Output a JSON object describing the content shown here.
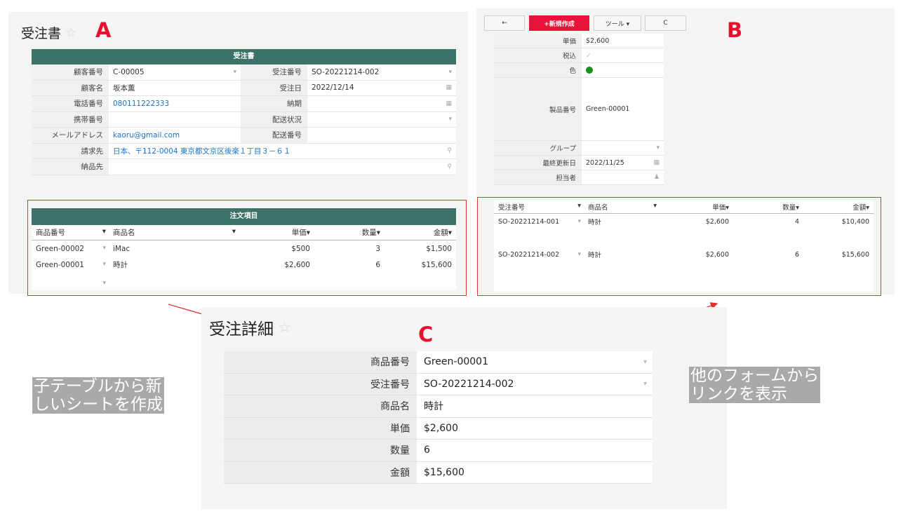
{
  "markers": {
    "a": "A",
    "b": "B",
    "c": "C"
  },
  "panel_a": {
    "title": "受注書",
    "form_header": "受注書",
    "rows": [
      {
        "l1": "顧客番号",
        "v1": "C-00005",
        "l2": "受注番号",
        "v2": "SO-20221214-002"
      },
      {
        "l1": "顧客名",
        "v1": "坂本薫",
        "l2": "受注日",
        "v2": "2022/12/14"
      },
      {
        "l1": "電話番号",
        "v1": "080111222333",
        "l2": "納期",
        "v2": ""
      },
      {
        "l1": "携帯番号",
        "v1": "",
        "l2": "配送状況",
        "v2": ""
      },
      {
        "l1": "メールアドレス",
        "v1": "kaoru@gmail.com",
        "l2": "配送番号",
        "v2": ""
      }
    ],
    "billing_label": "請求先",
    "billing_value": "日本、〒112-0004 東京都文京区後楽１丁目３－６１",
    "delivery_label": "納品先",
    "delivery_value": "",
    "items_header": "注文項目",
    "columns": [
      "商品番号",
      "商品名",
      "単価",
      "数量",
      "金額"
    ],
    "items": [
      {
        "code": "Green-00002",
        "name": "iMac",
        "price": "$500",
        "qty": "3",
        "amount": "$1,500"
      },
      {
        "code": "Green-00001",
        "name": "時計",
        "price": "$2,600",
        "qty": "6",
        "amount": "$15,600"
      }
    ]
  },
  "panel_b": {
    "toolbar": {
      "back": "←",
      "new": "+新規作成",
      "tools": "ツール ▾",
      "refresh": "C"
    },
    "fields": [
      {
        "label": "単価",
        "value": "$2,600"
      },
      {
        "label": "税込",
        "value": "✓"
      },
      {
        "label": "色",
        "value": ""
      },
      {
        "label": "製品番号",
        "value": "Green-00001"
      },
      {
        "label": "グループ",
        "value": ""
      },
      {
        "label": "最終更新日",
        "value": "2022/11/25"
      },
      {
        "label": "担当者",
        "value": ""
      }
    ],
    "color_dot": "#1a8f1a",
    "columns": [
      "受注番号",
      "商品名",
      "単価",
      "数量",
      "金額"
    ],
    "rows": [
      {
        "order": "SO-20221214-001",
        "name": "時計",
        "price": "$2,600",
        "qty": "4",
        "amount": "$10,400"
      },
      {
        "order": "SO-20221214-002",
        "name": "時計",
        "price": "$2,600",
        "qty": "6",
        "amount": "$15,600"
      }
    ]
  },
  "panel_c": {
    "title": "受注詳細",
    "rows": [
      {
        "label": "商品番号",
        "value": "Green-00001"
      },
      {
        "label": "受注番号",
        "value": "SO-20221214-002"
      },
      {
        "label": "商品名",
        "value": "時計"
      },
      {
        "label": "単価",
        "value": "$2,600"
      },
      {
        "label": "数量",
        "value": "6"
      },
      {
        "label": "金額",
        "value": "$15,600"
      }
    ]
  },
  "notes": {
    "left_line1": "子テーブルから新",
    "left_line2": "しいシートを作成",
    "right_line1": "他のフォームから",
    "right_line2": "リンクを表示"
  },
  "colors": {
    "teal": "#3d7269",
    "accent_red": "#e8112d",
    "link_blue": "#1a73c8"
  }
}
